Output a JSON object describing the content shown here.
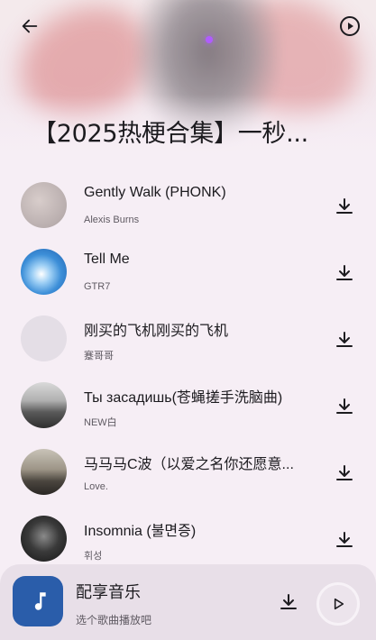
{
  "header": {
    "back_icon": "arrow-left-icon",
    "play_icon": "play-circle-icon"
  },
  "playlist": {
    "title": "【2025热梗合集】一秒..."
  },
  "songs": [
    {
      "title": "Gently Walk (PHONK)",
      "artist": "Alexis Burns",
      "avatar_color": "#cfc3c3"
    },
    {
      "title": "Tell Me",
      "artist": "GTR7",
      "avatar_color": "#3d8fd8"
    },
    {
      "title": "刚买的飞机刚买的飞机",
      "artist": "蹇哥哥",
      "avatar_color": "#e4dee6"
    },
    {
      "title": "Ты засадишь(苍蝇搓手洗脑曲)",
      "artist": "NEW白",
      "avatar_color": "#8a8a8a"
    },
    {
      "title": "马马马C波（以爱之名你还愿意...",
      "artist": "Love.",
      "avatar_color": "#6f6a60"
    },
    {
      "title": "Insomnia (불면증)",
      "artist": "휘성",
      "avatar_color": "#2a2a2a"
    }
  ],
  "player": {
    "title": "配享音乐",
    "subtitle": "选个歌曲播放吧",
    "cover_color": "#2a5daa",
    "cover_icon": "music-note-icon"
  },
  "colors": {
    "background": "#f6eef5",
    "player_bar": "#e8dfe8",
    "accent_blue": "#2a5daa"
  }
}
